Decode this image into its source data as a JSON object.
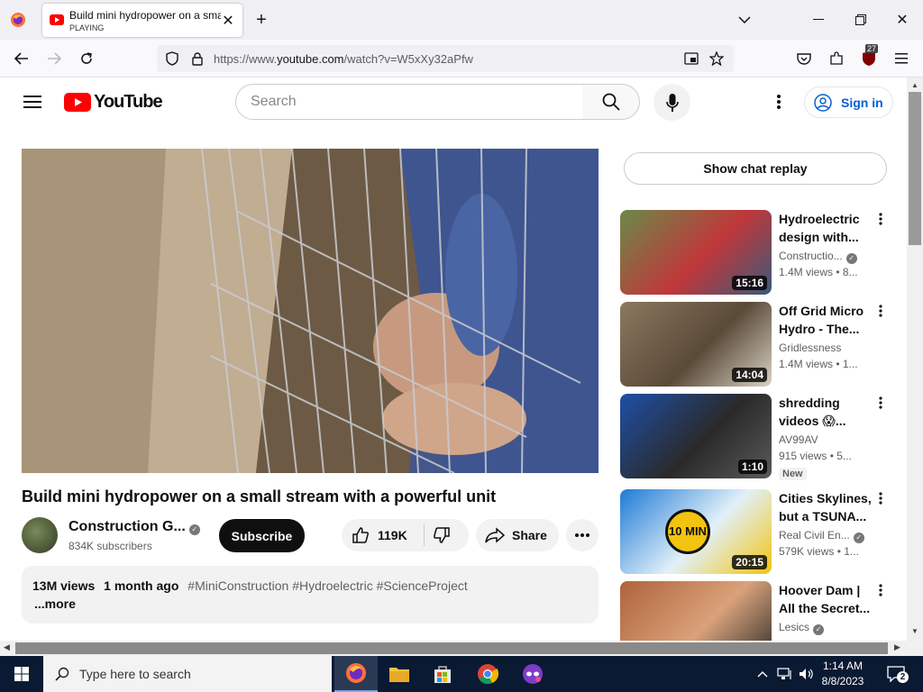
{
  "browser": {
    "tab_title": "Build mini hydropower on a small stream with a powerful unit - YouTube",
    "tab_status": "PLAYING",
    "url_prefix": "https://www.",
    "url_domain": "youtube.com",
    "url_path": "/watch?v=W5xXy32aPfw",
    "extension_badge": "27"
  },
  "header": {
    "logo_text": "YouTube",
    "search_placeholder": "Search",
    "sign_in": "Sign in"
  },
  "video": {
    "title": "Build mini hydropower on a small stream with a powerful unit",
    "channel": "Construction G...",
    "subscribers": "834K subscribers",
    "subscribe_label": "Subscribe",
    "likes": "119K",
    "share_label": "Share",
    "views": "13M views",
    "date": "1 month ago",
    "tags": "#MiniConstruction #Hydroelectric #ScienceProject",
    "more": "...more"
  },
  "sidebar": {
    "chat_replay": "Show chat replay",
    "recommendations": [
      {
        "line1": "Hydroelectric",
        "line2": "design with...",
        "channel": "Constructio...",
        "verified": true,
        "meta": "1.4M views  • 8...",
        "duration": "15:16",
        "new": false,
        "thumb_colors": [
          "#6b8a4a",
          "#3a5a7a",
          "#c0373a"
        ]
      },
      {
        "line1": "Off Grid Micro",
        "line2": "Hydro - The...",
        "channel": "Gridlessness",
        "verified": false,
        "meta": "1.4M views  • 1...",
        "duration": "14:04",
        "new": false,
        "thumb_colors": [
          "#8a7a60",
          "#d8d2c4",
          "#5a4a38"
        ]
      },
      {
        "line1": "shredding",
        "line2": "videos 😱...",
        "channel": "AV99AV",
        "verified": false,
        "meta": "915 views  • 5...",
        "duration": "1:10",
        "new": true,
        "new_label": "New",
        "thumb_colors": [
          "#1f4fa8",
          "#5a5a5a",
          "#2a2a2a"
        ]
      },
      {
        "line1": "Cities Skylines,",
        "line2": "but a TSUNA...",
        "channel": "Real Civil En...",
        "verified": true,
        "meta": "579K views  • 1...",
        "duration": "20:15",
        "new": false,
        "thumb_label": "10 MIN",
        "thumb_colors": [
          "#1e7ad6",
          "#f2c40f",
          "#e2f0f8"
        ]
      },
      {
        "line1": "Hoover Dam |",
        "line2": "All the Secret...",
        "channel": "Lesics",
        "verified": true,
        "meta": "",
        "duration": "",
        "new": false,
        "thumb_colors": [
          "#b0623a",
          "#2b2b2b",
          "#d9a27a"
        ]
      }
    ]
  },
  "taskbar": {
    "search_placeholder": "Type here to search",
    "time": "1:14 AM",
    "date": "8/8/2023",
    "notifications": "2"
  }
}
